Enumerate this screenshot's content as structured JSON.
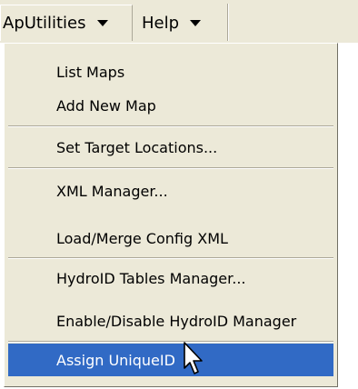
{
  "menubar": {
    "items": [
      {
        "label": "ApUtilities",
        "state": "open"
      },
      {
        "label": "Help"
      }
    ]
  },
  "menu": {
    "items": [
      {
        "label": "List Maps"
      },
      {
        "label": "Add New Map"
      },
      {
        "label": "Set Target Locations..."
      },
      {
        "label": "XML Manager..."
      },
      {
        "label": "Load/Merge Config XML"
      },
      {
        "label": "HydroID Tables Manager..."
      },
      {
        "label": "Enable/Disable HydroID Manager"
      },
      {
        "label": "Assign UniqueID",
        "state": "highlighted"
      }
    ]
  },
  "colors": {
    "menu_background": "#ece9d8",
    "highlight": "#316ac5",
    "highlight_text": "#ffffff"
  },
  "icons": [
    "chevron-down-icon",
    "mouse-pointer-icon"
  ]
}
